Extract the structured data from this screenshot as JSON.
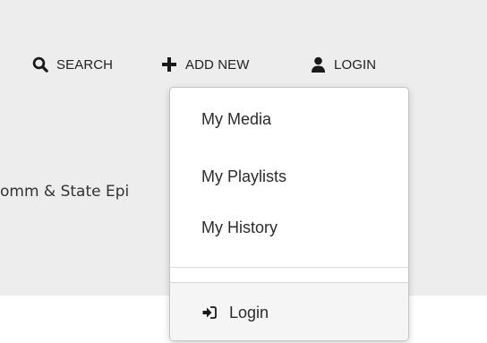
{
  "topnav": {
    "search": {
      "label": "SEARCH",
      "icon": "search-icon"
    },
    "add_new": {
      "label": "ADD NEW",
      "icon": "plus-icon"
    },
    "login": {
      "label": "LOGIN",
      "icon": "user-icon"
    }
  },
  "page": {
    "partial_title": "omm & State Epi"
  },
  "dropdown": {
    "items": [
      {
        "label": "My Media"
      },
      {
        "label": "My Playlists"
      },
      {
        "label": "My History"
      }
    ],
    "login": {
      "label": "Login",
      "icon": "sign-in-icon"
    }
  },
  "colors": {
    "header_background": "#ededed",
    "text": "#222222",
    "dropdown_background": "#ffffff",
    "login_row_background": "#f5f5f5"
  }
}
